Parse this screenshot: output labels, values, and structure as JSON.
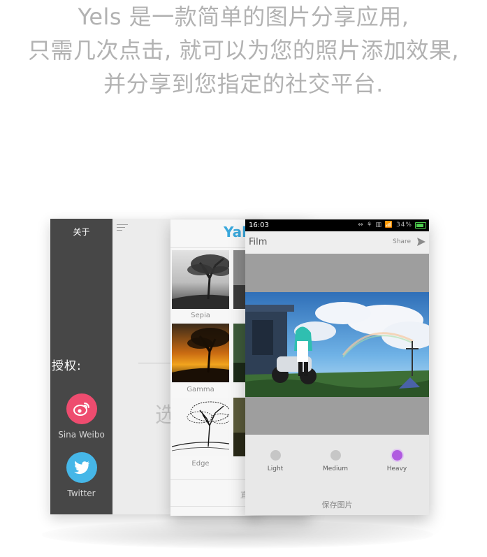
{
  "headline": {
    "line1": "Yels 是一款简单的图片分享应用,",
    "line2": "只需几次点击, 就可以为您的照片添加效果,",
    "line3": "并分享到您指定的社交平台."
  },
  "about_screen": {
    "title": "关于",
    "auth_label": "授权:",
    "partial_text": "选",
    "social": [
      {
        "name": "Sina Weibo",
        "icon": "weibo-icon",
        "color": "#ee4c6f"
      },
      {
        "name": "Twitter",
        "icon": "twitter-icon",
        "color": "#46b7e8"
      }
    ]
  },
  "gallery_screen": {
    "brand_partial": "Yal",
    "filters": [
      "Sepia",
      "Gamma",
      "Edge"
    ],
    "bottom_partial": "直"
  },
  "film_screen": {
    "status_time": "16:03",
    "status_icons": "⇔ ⚘ ▥ 📶 34%",
    "title": "Film",
    "share_label": "Share",
    "intensity_options": [
      "Light",
      "Medium",
      "Heavy"
    ],
    "selected_option": "Heavy",
    "save_label": "保存图片",
    "accent_color": "#b05ae0"
  }
}
